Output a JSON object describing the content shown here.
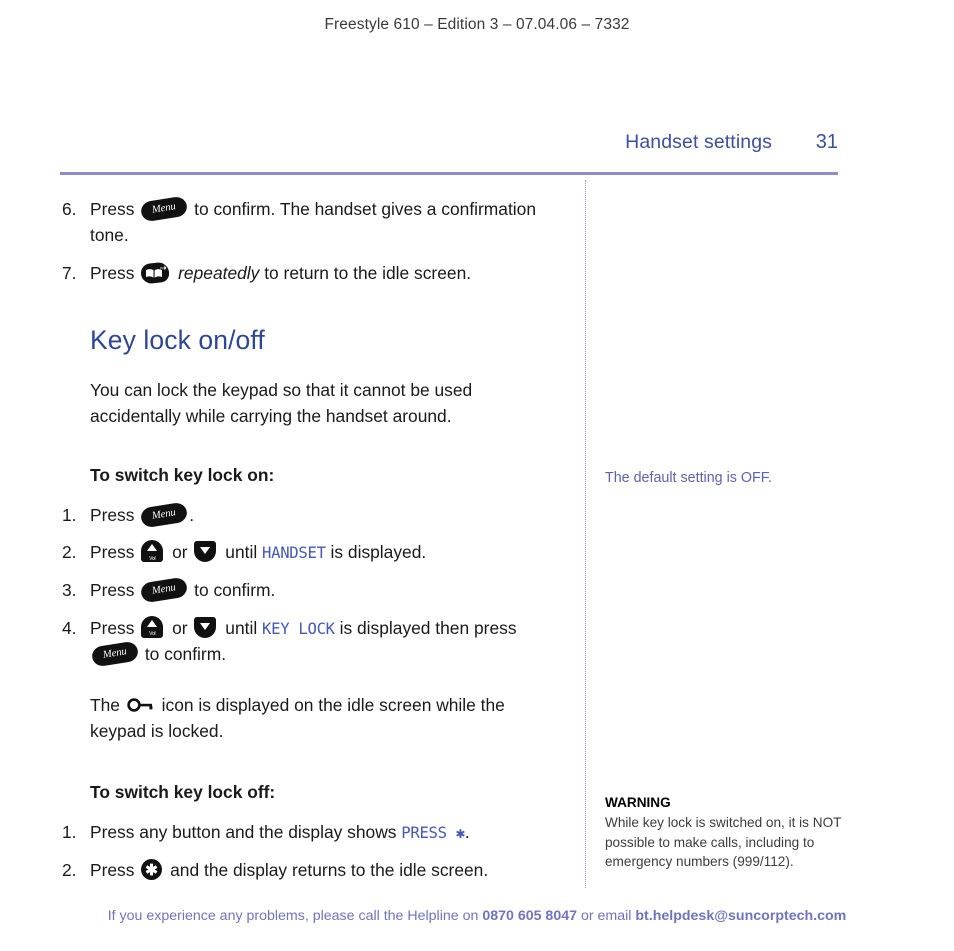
{
  "header": {
    "running_head": "Freestyle 610 – Edition 3 – 07.04.06 – 7332"
  },
  "title_row": {
    "chapter_title": "Handset settings",
    "page_number": "31"
  },
  "colors": {
    "heading_blue": "#2e4795",
    "chapter_blue": "#3c4fa0",
    "rule_blue": "#8b8fc8",
    "lcd_blue": "#4358b8",
    "side_note_blue": "#5b63b0",
    "footer_blue": "#6f74c0",
    "key_black": "#111111"
  },
  "main": {
    "continued_steps": [
      {
        "number": "6.",
        "pre": "Press",
        "icon": "menu-key-icon",
        "post": "to confirm. The handset gives a confirmation tone."
      },
      {
        "number": "7.",
        "pre": "Press",
        "icon": "phonebook-key-icon",
        "emphasis": "repeatedly",
        "post": "to return to the idle screen."
      }
    ],
    "section_heading": "Key lock on/off",
    "intro_paragraph": "You can lock the keypad so that it cannot be used accidentally while carrying the handset around.",
    "subhead_on": "To switch key lock on:",
    "steps_on": [
      {
        "number": "1.",
        "pre": "Press",
        "icon": "menu-key-icon",
        "post": "."
      },
      {
        "number": "2.",
        "pre": "Press",
        "icon_up": "up-key-icon",
        "mid": "or",
        "icon_down": "down-key-icon",
        "until": "until",
        "lcd": "HANDSET",
        "post": "is displayed."
      },
      {
        "number": "3.",
        "pre": "Press",
        "icon": "menu-key-icon",
        "post": "to confirm."
      },
      {
        "number": "4.",
        "pre": "Press",
        "icon_up": "up-key-icon",
        "mid": "or",
        "icon_down": "down-key-icon",
        "until": "until",
        "lcd": "KEY LOCK",
        "post": "is displayed then press",
        "icon2": "menu-key-icon",
        "post2": "to confirm."
      }
    ],
    "lock_note_pre": "The",
    "lock_note_icon": "key-lock-glyph-icon",
    "lock_note_post": "icon is displayed on the idle screen while the keypad is locked.",
    "subhead_off": "To switch key lock off:",
    "steps_off": [
      {
        "number": "1.",
        "pre": "Press any button and the display shows",
        "lcd": "PRESS ✱",
        "post": "."
      },
      {
        "number": "2.",
        "pre": "Press",
        "icon": "star-key-icon",
        "post": "and the display returns to the idle screen."
      }
    ]
  },
  "side": {
    "default_note": "The default setting is OFF.",
    "warning_title": "WARNING",
    "warning_body": "While key lock is switched on, it is NOT possible to make calls, including to emergency numbers (999/112)."
  },
  "footer": {
    "lead": "If you experience any problems, please call the Helpline on",
    "phone": "0870 605 8047",
    "middle": "or email",
    "email": "bt.helpdesk@suncorptech.com"
  }
}
